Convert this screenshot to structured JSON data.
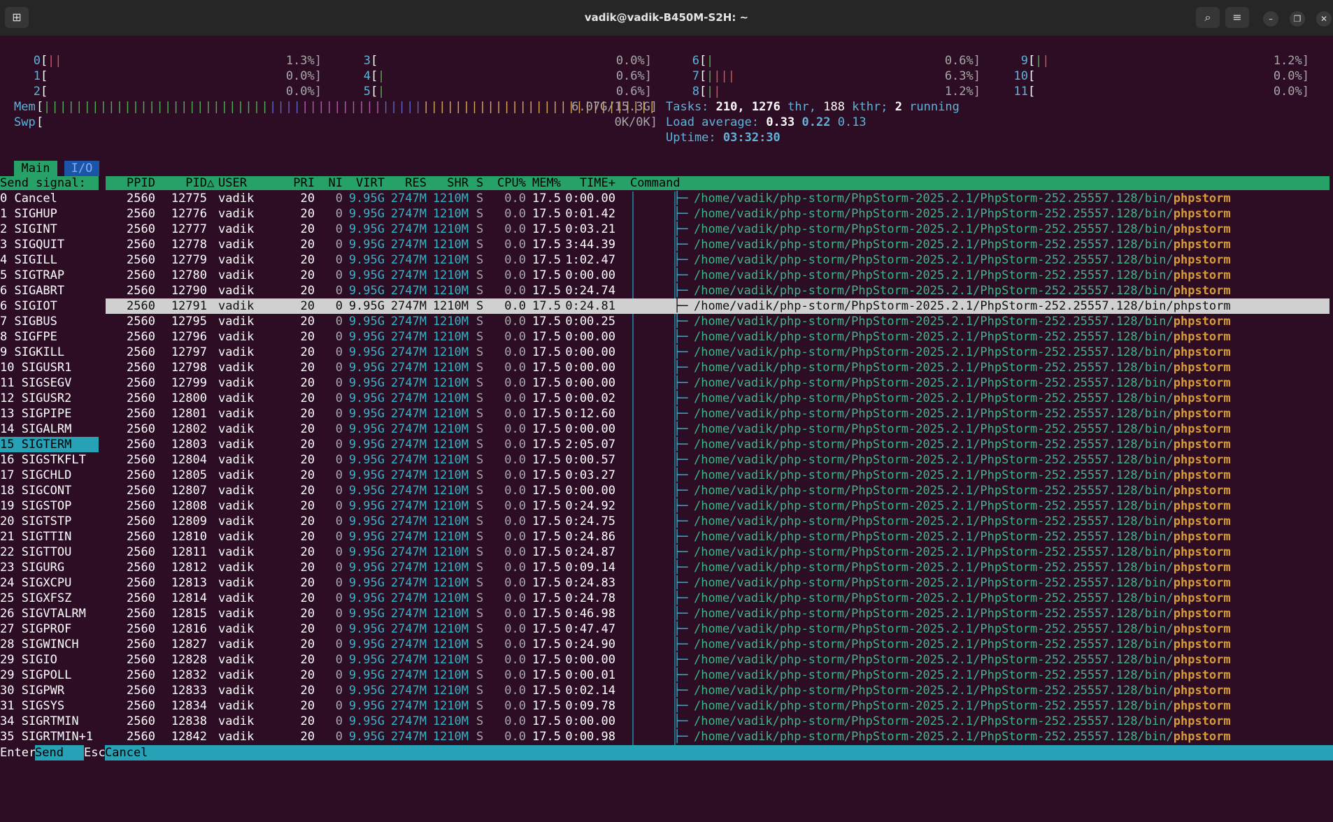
{
  "window": {
    "title": "vadik@vadik-B450M-S2H: ~"
  },
  "icons": {
    "new_tab": "new-tab-icon",
    "search": "search-icon",
    "menu": "hamburger-menu-icon",
    "minimize": "minimize-icon",
    "restore": "restore-icon",
    "close": "close-icon"
  },
  "cpus": [
    {
      "id": "0",
      "pct": "1.3%]",
      "bars": "||"
    },
    {
      "id": "1",
      "pct": "0.0%]",
      "bars": ""
    },
    {
      "id": "2",
      "pct": "0.0%]",
      "bars": ""
    },
    {
      "id": "3",
      "pct": "0.0%]",
      "bars": ""
    },
    {
      "id": "4",
      "pct": "0.6%]",
      "bars": "|"
    },
    {
      "id": "5",
      "pct": "0.6%]",
      "bars": "|"
    },
    {
      "id": "6",
      "pct": "0.6%]",
      "bars": "|"
    },
    {
      "id": "7",
      "pct": "6.3%]",
      "bars": "||||"
    },
    {
      "id": "8",
      "pct": "1.2%]",
      "bars": "||"
    },
    {
      "id": "9",
      "pct": "1.2%]",
      "bars": "||"
    },
    {
      "id": "10",
      "pct": "0.0%]",
      "bars": ""
    },
    {
      "id": "11",
      "pct": "0.0%]",
      "bars": ""
    }
  ],
  "mem": {
    "label": "Mem",
    "value": "6.07G/15.3G]"
  },
  "swp": {
    "label": "Swp",
    "value": "0K/0K]"
  },
  "tasks": {
    "label": "Tasks:",
    "count": "210",
    "thr": "1276",
    "thr_label": "thr,",
    "kthr": "188",
    "kthr_label": "kthr;",
    "running": "2",
    "running_label": "running"
  },
  "load": {
    "label": "Load average:",
    "v1": "0.33",
    "v2": "0.22",
    "v3": "0.13"
  },
  "uptime": {
    "label": "Uptime:",
    "value": "03:32:30"
  },
  "tabs": [
    {
      "label": "Main"
    },
    {
      "label": "I/O"
    }
  ],
  "signal_title": "Send signal:",
  "columns": {
    "ppid": "PPID",
    "pid": "PID",
    "sort": "△",
    "user": "USER",
    "pri": "PRI",
    "ni": "NI",
    "virt": "VIRT",
    "res": "RES",
    "shr": "SHR",
    "s": "S",
    "cpu": "CPU%",
    "mem": "MEM%",
    "time": "TIME+",
    "command": "Command"
  },
  "signals": [
    "0 Cancel",
    "1 SIGHUP",
    "2 SIGINT",
    "3 SIGQUIT",
    "4 SIGILL",
    "5 SIGTRAP",
    "6 SIGABRT",
    "6 SIGIOT",
    "7 SIGBUS",
    "8 SIGFPE",
    "9 SIGKILL",
    "10 SIGUSR1",
    "11 SIGSEGV",
    "12 SIGUSR2",
    "13 SIGPIPE",
    "14 SIGALRM",
    "15 SIGTERM",
    "16 SIGSTKFLT",
    "17 SIGCHLD",
    "18 SIGCONT",
    "19 SIGSTOP",
    "20 SIGTSTP",
    "21 SIGTTIN",
    "22 SIGTTOU",
    "23 SIGURG",
    "24 SIGXCPU",
    "25 SIGXFSZ",
    "26 SIGVTALRM",
    "27 SIGPROF",
    "28 SIGWINCH",
    "29 SIGIO",
    "29 SIGPOLL",
    "30 SIGPWR",
    "31 SIGSYS",
    "34 SIGRTMIN",
    "35 SIGRTMIN+1"
  ],
  "selected_signal_index": 16,
  "selected_process_index": 7,
  "process_common": {
    "ppid": "2560",
    "user": "vadik",
    "pri": "20",
    "ni": "0",
    "virt": "9.95G",
    "res": "2747M",
    "shr": "1210M",
    "state": "S",
    "cpu": "0.0",
    "mem": "17.5",
    "tree": "├─",
    "cmd_path": "/home/vadik/php-storm/PhpStorm-2025.2.1/PhpStorm-252.25557.128/bin/",
    "cmd_name": "phpstorm"
  },
  "processes": [
    {
      "pid": "12775",
      "time": "0:00.00"
    },
    {
      "pid": "12776",
      "time": "0:01.42"
    },
    {
      "pid": "12777",
      "time": "0:03.21"
    },
    {
      "pid": "12778",
      "time": "3:44.39"
    },
    {
      "pid": "12779",
      "time": "1:02.47"
    },
    {
      "pid": "12780",
      "time": "0:00.00"
    },
    {
      "pid": "12790",
      "time": "0:24.74"
    },
    {
      "pid": "12791",
      "time": "0:24.81"
    },
    {
      "pid": "12795",
      "time": "0:00.25"
    },
    {
      "pid": "12796",
      "time": "0:00.00"
    },
    {
      "pid": "12797",
      "time": "0:00.00"
    },
    {
      "pid": "12798",
      "time": "0:00.00"
    },
    {
      "pid": "12799",
      "time": "0:00.00"
    },
    {
      "pid": "12800",
      "time": "0:00.02"
    },
    {
      "pid": "12801",
      "time": "0:12.60"
    },
    {
      "pid": "12802",
      "time": "0:00.00"
    },
    {
      "pid": "12803",
      "time": "2:05.07"
    },
    {
      "pid": "12804",
      "time": "0:00.57"
    },
    {
      "pid": "12805",
      "time": "0:03.27"
    },
    {
      "pid": "12807",
      "time": "0:00.00"
    },
    {
      "pid": "12808",
      "time": "0:24.92"
    },
    {
      "pid": "12809",
      "time": "0:24.75"
    },
    {
      "pid": "12810",
      "time": "0:24.86"
    },
    {
      "pid": "12811",
      "time": "0:24.87"
    },
    {
      "pid": "12812",
      "time": "0:09.14"
    },
    {
      "pid": "12813",
      "time": "0:24.83"
    },
    {
      "pid": "12814",
      "time": "0:24.78"
    },
    {
      "pid": "12815",
      "time": "0:46.98"
    },
    {
      "pid": "12816",
      "time": "0:47.47"
    },
    {
      "pid": "12827",
      "time": "0:24.90"
    },
    {
      "pid": "12828",
      "time": "0:00.00"
    },
    {
      "pid": "12832",
      "time": "0:00.01"
    },
    {
      "pid": "12833",
      "time": "0:02.14"
    },
    {
      "pid": "12834",
      "time": "0:09.78"
    },
    {
      "pid": "12838",
      "time": "0:00.00"
    },
    {
      "pid": "12842",
      "time": "0:00.98"
    }
  ],
  "footer": {
    "enter_key": "Enter",
    "enter_label": "Send",
    "esc_key": "Esc",
    "esc_label": "Cancel"
  }
}
